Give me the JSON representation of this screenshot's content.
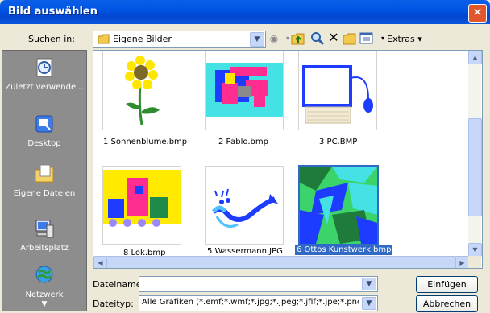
{
  "window": {
    "title": "Bild auswählen",
    "close_glyph": "✕"
  },
  "lookin": {
    "label": "Suchen in:",
    "value": "Eigene Bilder"
  },
  "toolbar": {
    "extras_label": "Extras"
  },
  "places": [
    {
      "label": "Zuletzt verwende...",
      "icon": "recent-icon"
    },
    {
      "label": "Desktop",
      "icon": "desktop-icon"
    },
    {
      "label": "Eigene Dateien",
      "icon": "my-documents-icon"
    },
    {
      "label": "Arbeitsplatz",
      "icon": "my-computer-icon"
    },
    {
      "label": "Netzwerk",
      "icon": "network-icon"
    }
  ],
  "files": [
    {
      "name": "1 Sonnenblume.bmp"
    },
    {
      "name": "2 Pablo.bmp"
    },
    {
      "name": "3 PC.BMP"
    },
    {
      "name": "8 Lok.bmp"
    },
    {
      "name": "5 Wassermann.JPG"
    },
    {
      "name": "6 Ottos Kunstwerk.bmp",
      "selected": true
    }
  ],
  "filename": {
    "label": "Dateiname:",
    "value": ""
  },
  "filetype": {
    "label": "Dateityp:",
    "value": "Alle Grafiken (*.emf;*.wmf;*.jpg;*.jpeg;*.jfif;*.jpe;*.pnc"
  },
  "buttons": {
    "insert": "Einfügen",
    "cancel": "Abbrechen"
  },
  "colors": {
    "title_bar": "#0055e5",
    "selection": "#316ac5",
    "places_bar": "#8d8d8d"
  }
}
